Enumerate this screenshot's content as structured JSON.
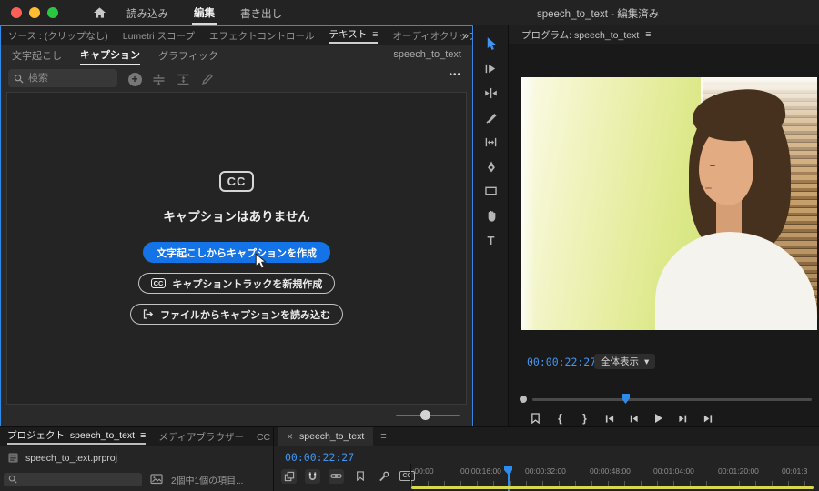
{
  "colors": {
    "accent_blue": "#1473e6",
    "focus_border_blue": "#2d8ceb",
    "timecode_blue": "#4096f3",
    "playhead_blue": "#2d8ceb",
    "work_area_yellow": "#d8d84f",
    "traffic_red": "#ff5f57",
    "traffic_yellow": "#febc2e",
    "traffic_green": "#28c840"
  },
  "glyphs": {
    "panel_menu": "≡",
    "tab_overflow": "»",
    "chevron_down": "▾",
    "close": "×",
    "more_dots": "•••",
    "brace_open": "{",
    "brace_close": "}",
    "type_tool": "T",
    "cc_badge": "CC"
  },
  "titlebar": {
    "menu_import": "読み込み",
    "menu_edit": "編集",
    "menu_export": "書き出し",
    "title": "speech_to_text - 編集済み"
  },
  "left_group": {
    "tabs": [
      {
        "label": "ソース : (クリップなし)"
      },
      {
        "label": "Lumetri スコープ"
      },
      {
        "label": "エフェクトコントロール"
      },
      {
        "label": "テキスト"
      },
      {
        "label": "オーディオクリップミ"
      }
    ]
  },
  "text_panel": {
    "tab_transcript": "文字起こし",
    "tab_captions": "キャプション",
    "tab_graphics": "グラフィック",
    "sequence_label": "speech_to_text",
    "search_placeholder": "検索",
    "empty": {
      "title": "キャプションはありません",
      "btn_create_from_transcript": "文字起こしからキャプションを作成",
      "btn_new_track": "キャプショントラックを新規作成",
      "btn_import_file": "ファイルからキャプションを読み込む"
    }
  },
  "tools": {
    "active": "selection",
    "items": [
      "selection",
      "track-select-forward",
      "ripple-edit",
      "razor",
      "slip",
      "pen",
      "rectangle",
      "hand",
      "type"
    ]
  },
  "program_panel": {
    "tab": "プログラム: speech_to_text",
    "timecode": "00:00:22:27",
    "zoom_select": "全体表示"
  },
  "project_panel": {
    "tab_project": "プロジェクト: speech_to_text",
    "tab_media_browser": "メディアブラウザー",
    "tab_cc_libraries": "CC ラ",
    "file_name": "speech_to_text.prproj",
    "status_text": "2個中1個の項目..."
  },
  "timeline_panel": {
    "tab": "speech_to_text",
    "timecode": "00:00:22:27",
    "ruler_labels": [
      ":00:00",
      "00:00:16:00",
      "00:00:32:00",
      "00:00:48:00",
      "00:01:04:00",
      "00:01:20:00",
      "00:01:3"
    ]
  }
}
